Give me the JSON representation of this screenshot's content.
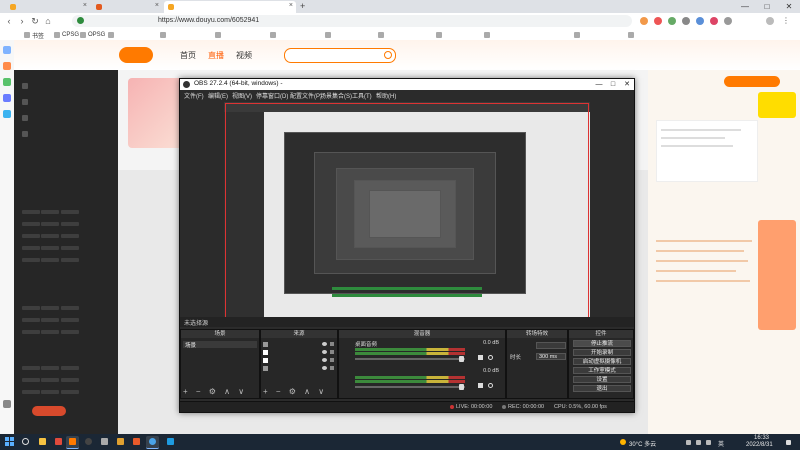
{
  "browser": {
    "tabs": [
      {
        "label": ""
      },
      {
        "label": ""
      },
      {
        "label": ""
      }
    ],
    "tab_close_symbol": "×",
    "new_tab_symbol": "+",
    "window_controls": [
      "—",
      "□",
      "✕"
    ],
    "address_url": "https://www.douyu.com/6052941",
    "address_site_label": "",
    "bookmarks": [
      "书签",
      "CPSG",
      "OPSG",
      "",
      "",
      "",
      "",
      "",
      "",
      "",
      "",
      "",
      ""
    ]
  },
  "douyu": {
    "nav": [
      "首页",
      "直播",
      "视频"
    ],
    "sidebar_items": [
      "",
      "",
      "",
      ""
    ],
    "sidebar_grid_rows": 8,
    "right_panel_pill": ""
  },
  "overlay": {
    "top_lines": [
      "",
      "",
      ""
    ],
    "left_lines": [
      "",
      "",
      "",
      "",
      "",
      ""
    ]
  },
  "obs": {
    "title": "OBS 27.2.4 (64-bit, windows) -",
    "menu": [
      "文件(F)",
      "编辑(E)",
      "视图(V)",
      "停靠窗口(D)",
      "配置文件(P)",
      "场景集合(S)",
      "工具(T)",
      "帮助(H)"
    ],
    "preview_tabrow": [
      "未选择源",
      "",
      ""
    ],
    "docks": {
      "scenes_title": "场景",
      "sources_title": "来源",
      "mixer_title": "混音器",
      "transitions_title": "转场特效",
      "controls_title": "控件"
    },
    "scenes": [
      "场景"
    ],
    "sources": [
      "",
      "",
      "",
      ""
    ],
    "mixer": [
      {
        "name": "桌面音频",
        "db": "0.0 dB"
      },
      {
        "name": "",
        "db": "0.0 dB"
      }
    ],
    "transitions": [
      {
        "label": "",
        "value": ""
      },
      {
        "label": "时长",
        "value": "300 ms"
      }
    ],
    "controls": [
      "停止推流",
      "开始录制",
      "启动虚拟摄像机",
      "工作室模式",
      "设置",
      "退出"
    ],
    "dock_footer_symbols": "+ − ⚙ ∧ ∨",
    "status": {
      "live": "LIVE: 00:00:00",
      "rec": "REC: 00:00:00",
      "cpu": "CPU: 0.5%, 60.00 fps"
    }
  },
  "taskbar": {
    "weather": "30°C 多云",
    "language": "英",
    "time": "16:33",
    "date": "2022/8/31"
  },
  "colors": {
    "douyu_orange": "#ff7a00",
    "obs_dark": "#2b2b2b",
    "taskbar": "#1b2735"
  }
}
